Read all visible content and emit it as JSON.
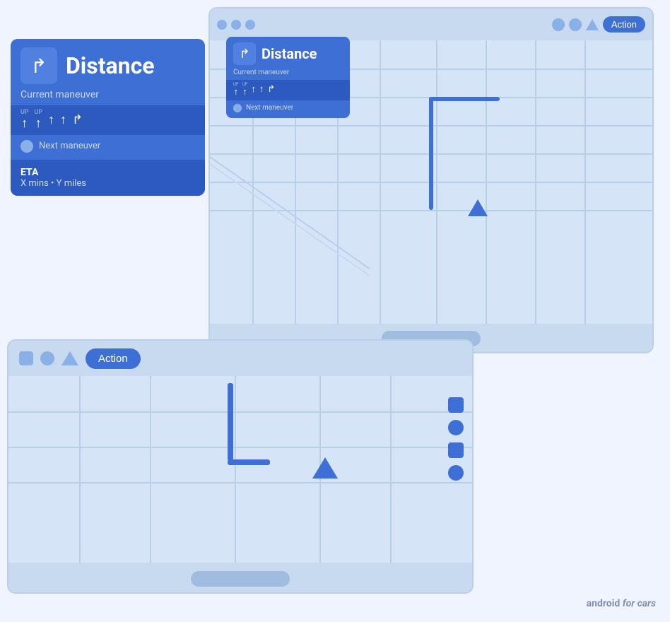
{
  "small_screen": {
    "top_bar_dots": [
      "dot1",
      "dot2",
      "dot3",
      "dot4",
      "dot5",
      "dot6",
      "dot7",
      "dot8"
    ],
    "action_label": "Action"
  },
  "large_screen": {
    "top_bar_dots": [
      "dot1",
      "dot2",
      "dot3"
    ],
    "action_label": "Action"
  },
  "nav_card_small": {
    "distance": "Distance",
    "maneuver_label": "Current maneuver",
    "next_label": "Next maneuver",
    "lanes": [
      "UP",
      "UP",
      "↑",
      "↑",
      "↱"
    ]
  },
  "nav_card_large": {
    "distance": "Distance",
    "maneuver_label": "Current maneuver",
    "next_label": "Next maneuver",
    "lanes": [
      "UP",
      "UP",
      "↑",
      "↑",
      "↱"
    ],
    "eta_title": "ETA",
    "eta_detail": "X mins • Y miles"
  },
  "watermark": {
    "prefix": "android ",
    "bold": "for cars"
  }
}
